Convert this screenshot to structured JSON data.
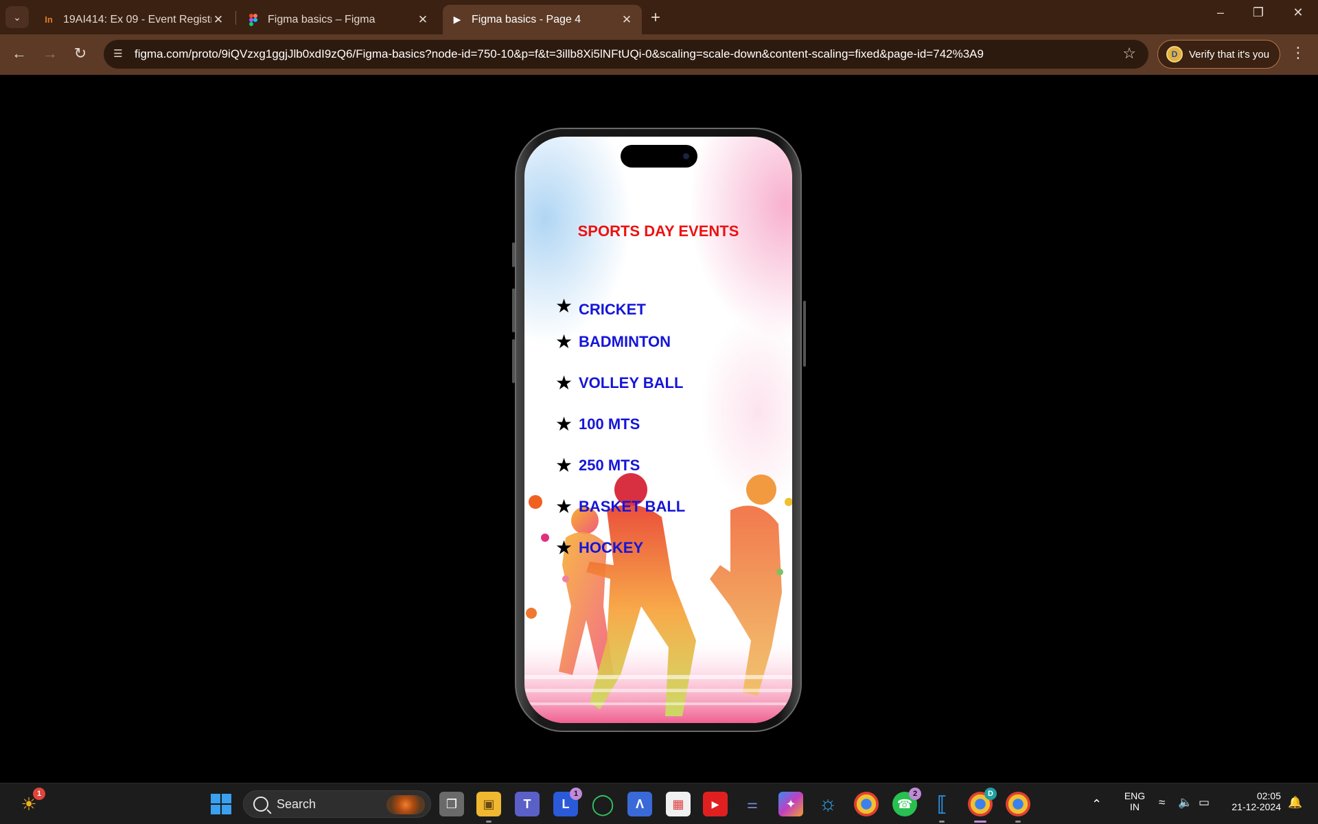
{
  "browser": {
    "tabs": [
      {
        "title": "19AI414: Ex 09 - Event Registrat",
        "favicon": "In",
        "favicon_color": "#e07b2a",
        "active": false
      },
      {
        "title": "Figma basics – Figma",
        "favicon": "figma-icon",
        "active": false
      },
      {
        "title": "Figma basics - Page 4",
        "favicon": "play-icon",
        "active": true
      }
    ],
    "url": "figma.com/proto/9iQVzxg1ggjJlb0xdI9zQ6/Figma-basics?node-id=750-10&p=f&t=3illb8Xi5lNFtUQi-0&scaling=scale-down&content-scaling=fixed&page-id=742%3A9",
    "verify_label": "Verify that it's you",
    "profile_initial": "D"
  },
  "prototype": {
    "heading": "SPORTS DAY EVENTS",
    "bullet": "★",
    "events": [
      "CRICKET",
      "BADMINTON",
      "VOLLEY BALL",
      "100 MTS",
      "250 MTS",
      "BASKET BALL",
      "HOCKEY"
    ],
    "colors": {
      "heading": "#ee1111",
      "event": "#1515d8"
    }
  },
  "taskbar": {
    "search_label": "Search",
    "weather_badge": "1",
    "loop_badge": "1",
    "whatsapp_badge": "2",
    "chrome_profile": "D",
    "language": "ENG",
    "region": "IN",
    "time": "02:05",
    "date": "21-12-2024"
  }
}
